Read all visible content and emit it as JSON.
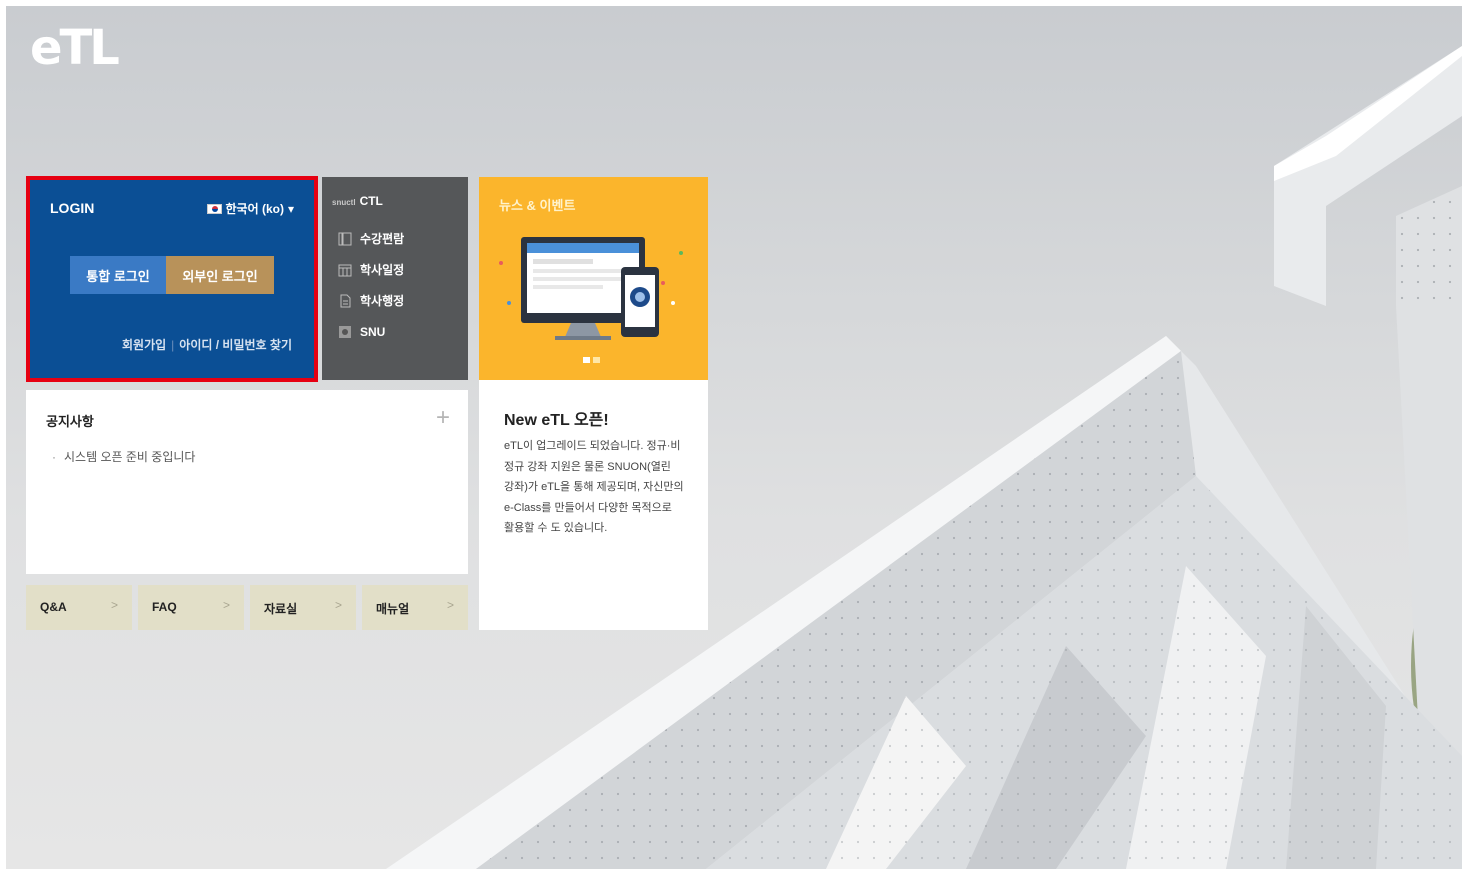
{
  "brand": {
    "logo_text": "eTL"
  },
  "login": {
    "title": "LOGIN",
    "language": "한국어 (ko)",
    "unified_login_label": "통합 로그인",
    "foreign_login_label": "외부인 로그인",
    "signup_label": "회원가입",
    "find_account_label": "아이디 / 비밀번호 찾기",
    "colors": {
      "panel": "#0b4f95",
      "highlight_border": "#e60012",
      "unified_btn": "#3a7ac5",
      "foreign_btn": "#b8925a"
    }
  },
  "quick_menu": {
    "prefix": "snuctl",
    "title": "CTL",
    "items": [
      {
        "label": "수강편람",
        "icon": "book-icon"
      },
      {
        "label": "학사일정",
        "icon": "calendar-icon"
      },
      {
        "label": "학사행정",
        "icon": "document-icon"
      },
      {
        "label": "SNU",
        "icon": "snu-emblem-icon"
      }
    ]
  },
  "news": {
    "title": "뉴스 & 이벤트",
    "slides": 2,
    "active_slide": 1,
    "color": "#fbb52c"
  },
  "notice": {
    "title": "공지사항",
    "more_label": "+",
    "items": [
      "시스템 오픈 준비 중입니다"
    ]
  },
  "article": {
    "title": "New eTL 오픈!",
    "body": "eTL이 업그레이드 되었습니다. 정규·비정규 강좌 지원은 물론 SNUON(열린 강좌)가 eTL을 통해 제공되며, 자신만의 e-Class를 만들어서 다양한 목적으로 활용할 수 도 있습니다."
  },
  "tiles": [
    {
      "label": "Q&A",
      "arrow": ">"
    },
    {
      "label": "FAQ",
      "arrow": ">"
    },
    {
      "label": "자료실",
      "arrow": ">"
    },
    {
      "label": "매뉴얼",
      "arrow": ">"
    }
  ]
}
